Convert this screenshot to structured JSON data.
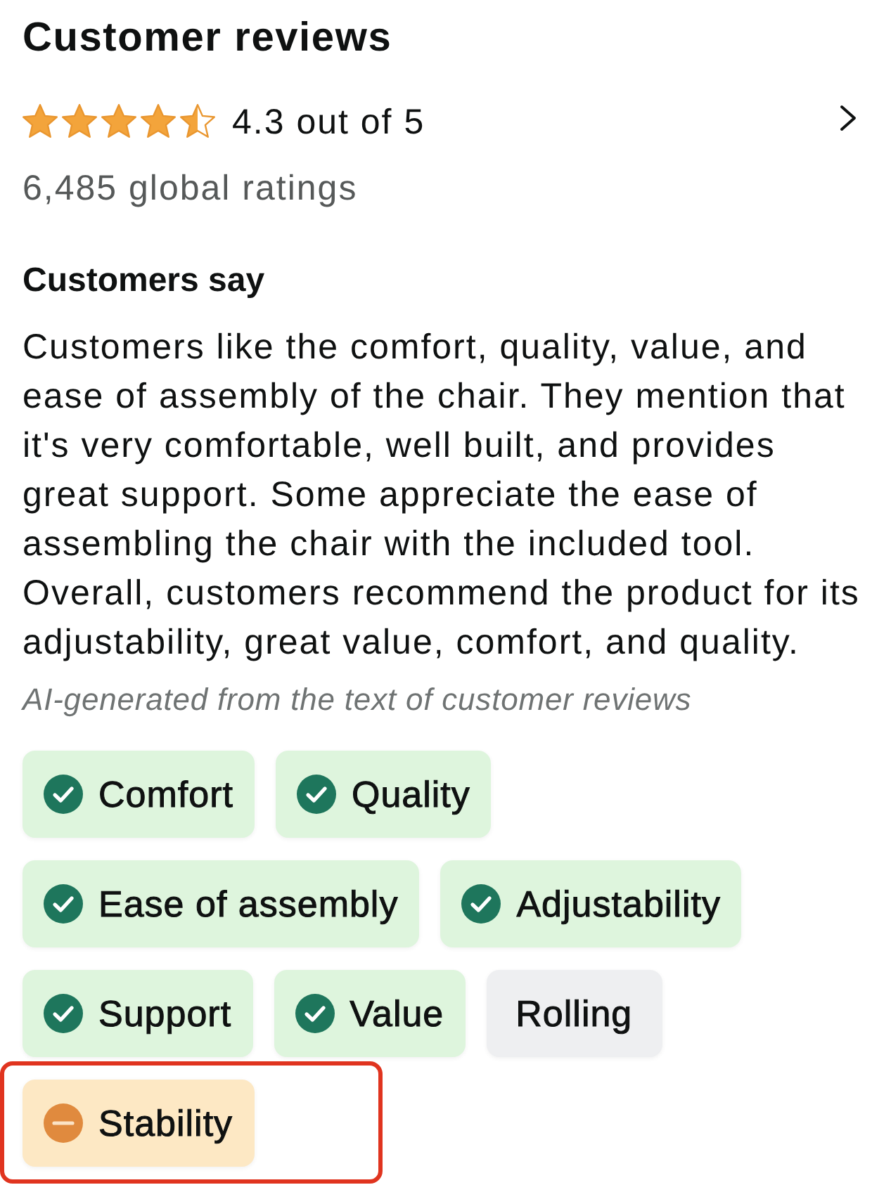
{
  "header": {
    "title": "Customer reviews",
    "rating": {
      "stars": 4.5,
      "text": "4.3 out of 5"
    },
    "ratings_count": "6,485 global ratings"
  },
  "summary": {
    "heading": "Customers say",
    "text": "Customers like the comfort, quality, value, and ease of assembly of the chair. They mention that it's very comfortable, well built, and provides great support. Some appreciate the ease of assembling the chair with the included tool. Overall, customers recommend the product for its adjustability, great value, comfort, and quality.",
    "note": "AI-generated from the text of customer reviews"
  },
  "aspects": [
    {
      "label": "Comfort",
      "kind": "positive",
      "highlighted": false
    },
    {
      "label": "Quality",
      "kind": "positive",
      "highlighted": false
    },
    {
      "label": "Ease of assembly",
      "kind": "positive",
      "highlighted": false
    },
    {
      "label": "Adjustability",
      "kind": "positive",
      "highlighted": false
    },
    {
      "label": "Support",
      "kind": "positive",
      "highlighted": false
    },
    {
      "label": "Value",
      "kind": "positive",
      "highlighted": false
    },
    {
      "label": "Rolling",
      "kind": "neutral",
      "highlighted": false
    },
    {
      "label": "Stability",
      "kind": "negative",
      "highlighted": true
    }
  ]
}
